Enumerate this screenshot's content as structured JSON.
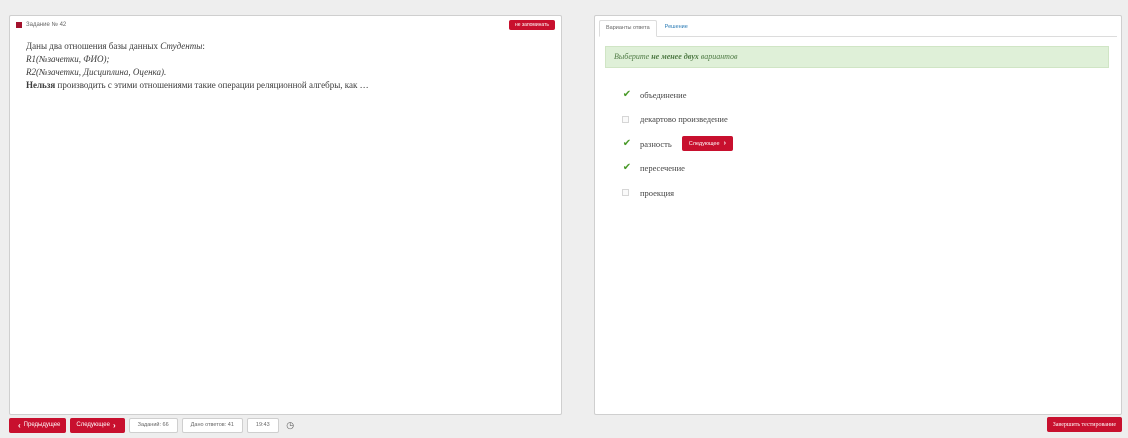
{
  "task": {
    "header": "Задание № 42",
    "no_remember_label": "не запоминать",
    "question_lines": [
      {
        "text": "Даны два отношения базы данных ",
        "italic": "Студенты",
        "suffix": ":"
      },
      {
        "italic_full": "R1(№зачетки, ФИО);"
      },
      {
        "italic_full": "R2(№зачетки, Дисциплина, Оценка)."
      },
      {
        "bold": "Нельзя",
        "text": " производить с этими отношениями такие операции реляционной алгебры, как …"
      }
    ]
  },
  "tabs": [
    {
      "label": "Варианты ответа",
      "active": true
    },
    {
      "label": "Решение",
      "active": false
    }
  ],
  "hint": {
    "prefix": "Выберите ",
    "bold": "не менее двух",
    "suffix": " вариантов"
  },
  "options": [
    {
      "label": "объединение",
      "checked": true
    },
    {
      "label": "декартово произведение",
      "checked": false
    },
    {
      "label": "разность",
      "checked": true
    },
    {
      "label": "пересечение",
      "checked": true
    },
    {
      "label": "проекция",
      "checked": false
    }
  ],
  "inline_next_label": "Следующее",
  "bottom": {
    "prev_label": "Предыдущее",
    "next_label": "Следующее",
    "tasks_label": "Заданий: 66",
    "answered_label": "Дано ответов: 41",
    "time_label": "19:43",
    "finish_label": "Завершить тестирование"
  },
  "colors": {
    "accent_red": "#c8102e",
    "hint_bg": "#dff0d8",
    "check_green": "#4a9a2a",
    "link_blue": "#2a7bb5"
  },
  "icons": {
    "check": "check-icon",
    "clock": "clock-icon",
    "chevron_left": "chevron-left-icon",
    "chevron_right": "chevron-right-icon"
  }
}
